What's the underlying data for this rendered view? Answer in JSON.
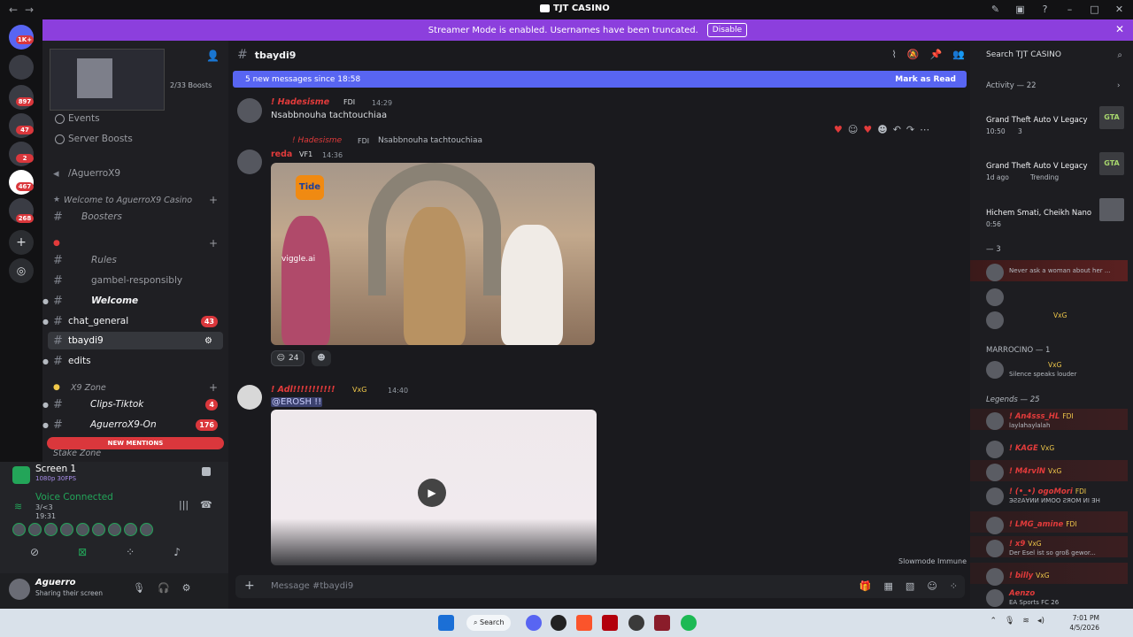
{
  "window": {
    "title": "TJT CASINO"
  },
  "banner": {
    "text": "Streamer Mode is enabled. Usernames have been truncated.",
    "button": "Disable"
  },
  "guilds": {
    "badges": [
      "1K+",
      "897",
      "47",
      "2",
      "467",
      "268"
    ]
  },
  "sidebar": {
    "boosts": "2/33 Boosts",
    "items": [
      {
        "label": "Events"
      },
      {
        "label": "Server Boosts"
      },
      {
        "label": "/AguerroX9"
      },
      {
        "label": "Welcome to AguerroX9 Casino"
      },
      {
        "label": "Boosters"
      },
      {
        "label": "Rules"
      },
      {
        "label": "gambel-responsibly"
      },
      {
        "label": "Welcome"
      },
      {
        "label": "chat_general",
        "badge": "43"
      },
      {
        "label": "tbaydi9"
      },
      {
        "label": "edits"
      },
      {
        "label": "X9 Zone"
      },
      {
        "label": "Clips-Tiktok",
        "badge": "4"
      },
      {
        "label": "AguerroX9-On",
        "badge": "176"
      },
      {
        "label": "Stake Zone"
      }
    ],
    "new_mentions": "NEW MENTIONS"
  },
  "panel": {
    "screen_title": "Screen 1",
    "screen_sub": "1080p 30FPS",
    "voice_title": "Voice Connected",
    "voice_sub": "3/<3",
    "voice_time": "19:31",
    "user_name": "Aguerro",
    "user_status": "Sharing their screen"
  },
  "channel": {
    "name": "tbaydi9"
  },
  "newbar": {
    "text": "5 new messages since 18:58",
    "action": "Mark as Read"
  },
  "messages": [
    {
      "user": "! Hadesisme",
      "tag": "FDI",
      "time": "14:29",
      "text": "Nsabbnouha tachtouchiaa"
    },
    {
      "reply_user": "! Hadesisme",
      "reply_tag": "FDI",
      "reply_text": "Nsabbnouha tachtouchiaa",
      "user": "reda",
      "tag": "VF1",
      "time": "14:36",
      "reaction_count": "24",
      "watermark": "viggle.ai",
      "brand": "Tide"
    },
    {
      "user": "! Adl!!!!!!!!!!!",
      "tag": "VxG",
      "time": "14:40",
      "text": "@EROSH !!"
    }
  ],
  "slowmode": "Slowmode Immune",
  "composer": {
    "placeholder": "Message #tbaydi9"
  },
  "right": {
    "search": "Search TJT CASINO",
    "activity_header": "Activity — 22",
    "activities": [
      {
        "name": "Grand Theft Auto V Legacy",
        "meta": "10:50",
        "count": "3"
      },
      {
        "name": "Grand Theft Auto V Legacy",
        "meta": "1d ago",
        "extra": "Trending"
      },
      {
        "name": "Hichem Smati, Cheikh Nano",
        "meta": "0:56"
      }
    ],
    "group1": "— 3",
    "group1_sub": "Never ask a woman about her ...",
    "marrocino": "MARROCINO — 1",
    "marrocino_sub": "Silence speaks louder",
    "legends": "Legends — 25",
    "members": [
      {
        "name": "! An4sss_HL",
        "tag": "FDI",
        "sub": "laylahaylalah"
      },
      {
        "name": "! KAGE",
        "tag": "VxG",
        "sub": ""
      },
      {
        "name": "! M4rvlN",
        "tag": "VxG",
        "sub": ""
      },
      {
        "name": "! (•_•) ogoMori",
        "tag": "FDI",
        "sub": "ЭƧƧA∀ИИ ИMOO ƧЯOM ИI ƎH"
      },
      {
        "name": "! LMG_amine",
        "tag": "FDI",
        "sub": ""
      },
      {
        "name": "! x9",
        "tag": "VxG",
        "sub": "Der Esel ist so groß gewor..."
      },
      {
        "name": "! billy",
        "tag": "VxG",
        "sub": ""
      },
      {
        "name": "Aenzo",
        "tag": "",
        "sub": "EA Sports FC 26"
      }
    ]
  },
  "taskbar": {
    "search": "Search",
    "time": "7:01 PM",
    "date": "4/5/2026"
  }
}
